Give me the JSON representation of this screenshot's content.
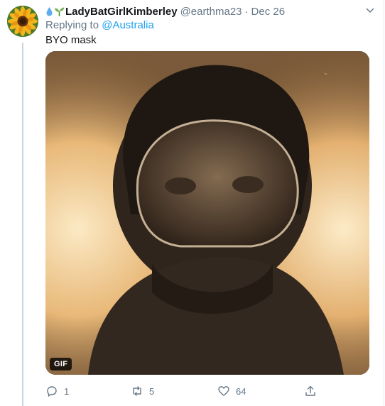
{
  "tweet": {
    "emojis": [
      "droplet-icon",
      "seedling-icon"
    ],
    "display_name": "LadyBatGirlKimberley",
    "handle": "@earthma23",
    "separator": "·",
    "date": "Dec 26",
    "reply_prefix": "Replying to",
    "reply_to": "@Australia",
    "text": "BYO mask",
    "media": {
      "badge": "GIF"
    },
    "actions": {
      "reply_count": "1",
      "retweet_count": "5",
      "like_count": "64",
      "share_count": ""
    }
  },
  "colors": {
    "link": "#1da1f2",
    "muted": "#657786",
    "text": "#14171a"
  }
}
